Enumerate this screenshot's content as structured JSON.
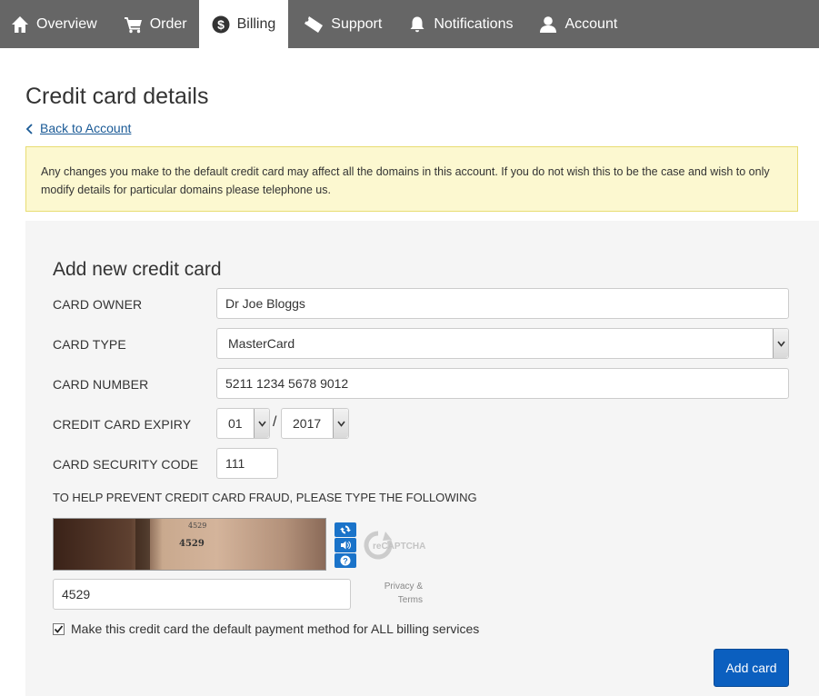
{
  "nav": {
    "items": [
      {
        "label": "Overview",
        "icon": "home-icon"
      },
      {
        "label": "Order",
        "icon": "cart-icon"
      },
      {
        "label": "Billing",
        "icon": "dollar-icon",
        "active": true
      },
      {
        "label": "Support",
        "icon": "ticket-icon"
      },
      {
        "label": "Notifications",
        "icon": "bell-icon"
      },
      {
        "label": "Account",
        "icon": "user-icon"
      }
    ]
  },
  "header": {
    "title": "Credit card details",
    "back_link": "Back to Account"
  },
  "notice": {
    "text": "Any changes you make to the default credit card may affect all the domains in this account. If you do not wish this to be the case and wish to only modify details for particular domains please telephone us."
  },
  "form": {
    "title": "Add new credit card",
    "card_owner": {
      "label": "CARD OWNER",
      "value": "Dr Joe Bloggs"
    },
    "card_type": {
      "label": "CARD TYPE",
      "value": "MasterCard"
    },
    "card_number": {
      "label": "CARD NUMBER",
      "value": "5211 1234 5678 9012"
    },
    "expiry": {
      "label": "CREDIT CARD EXPIRY",
      "month": "01",
      "separator": "/",
      "year": "2017"
    },
    "security_code": {
      "label": "CARD SECURITY CODE",
      "value": "111"
    },
    "fraud_note": "TO HELP PREVENT CREDIT CARD FRAUD, PLEASE TYPE THE FOLLOWING",
    "captcha": {
      "image_text": "4529",
      "response_value": "4529",
      "logo_text": "reCAPTCHA",
      "privacy_line1": "Privacy &",
      "privacy_line2": "Terms"
    },
    "default_checkbox": {
      "checked": true,
      "label": "Make this credit card the default payment method for ALL billing services"
    },
    "submit_label": "Add card"
  },
  "colors": {
    "nav_bg": "#666666",
    "notice_bg": "#fcf8d0",
    "button_primary": "#0b5fbf",
    "link": "#1a5a96"
  }
}
